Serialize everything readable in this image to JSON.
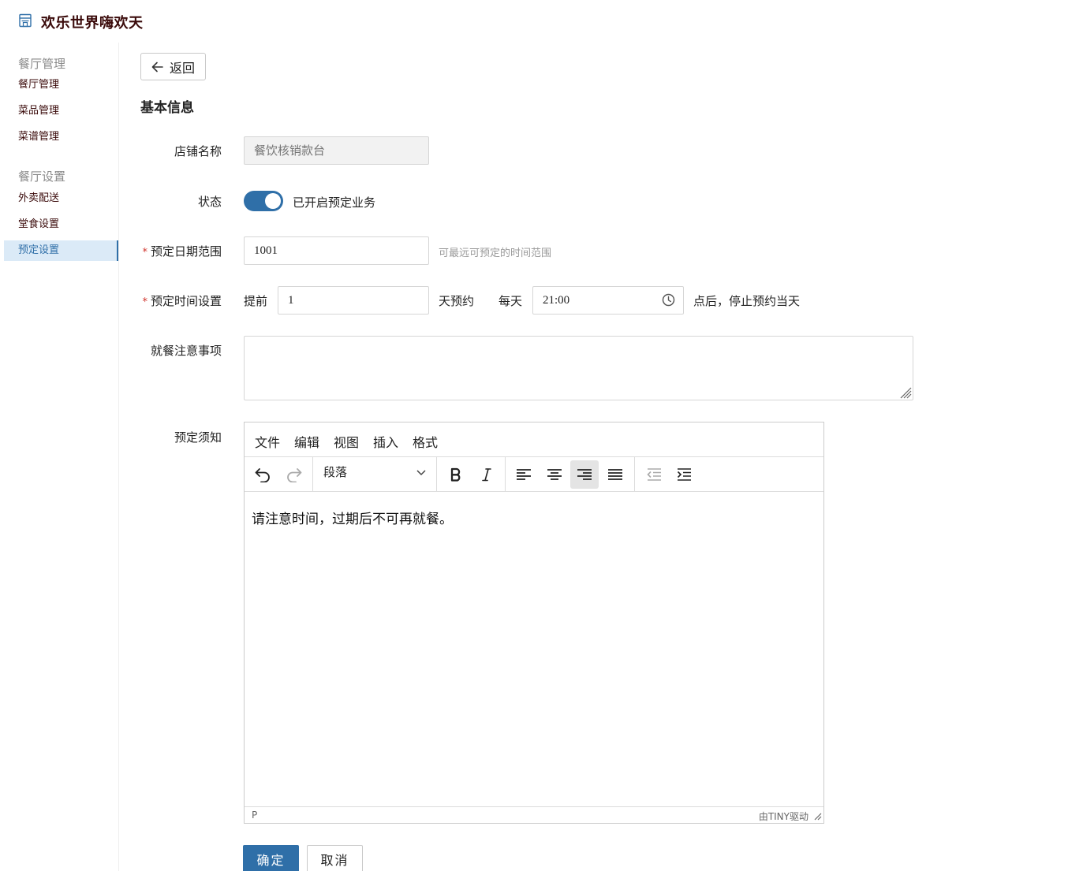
{
  "header": {
    "title": "欢乐世界嗨欢天",
    "logo_icon": "store-icon"
  },
  "sidebar": {
    "groups": [
      {
        "label": "餐厅管理",
        "items": [
          "餐厅管理",
          "菜品管理",
          "菜谱管理"
        ]
      },
      {
        "label": "餐厅设置",
        "items": [
          "外卖配送",
          "堂食设置",
          "预定设置"
        ]
      }
    ],
    "active_item": "预定设置"
  },
  "main": {
    "back_label": "返回",
    "section_title": "基本信息",
    "fields": {
      "store_name": {
        "label": "店铺名称",
        "placeholder": "餐饮核销款台"
      },
      "status": {
        "label": "状态",
        "on": true,
        "text": "已开启预定业务"
      },
      "date_range": {
        "label": "预定日期范围",
        "value": "1001",
        "hint": "可最远可预定的时间范围"
      },
      "time_setting": {
        "label": "预定时间设置",
        "prefix": "提前",
        "days": "1",
        "days_suffix": "天预约",
        "daily": "每天",
        "time": "21:00",
        "suffix": "点后，停止预约当天"
      },
      "dining_notes": {
        "label": "就餐注意事项",
        "value": ""
      },
      "booking_notice": {
        "label": "预定须知"
      }
    },
    "editor": {
      "menus": [
        "文件",
        "编辑",
        "视图",
        "插入",
        "格式"
      ],
      "block_format": "段落",
      "content": "请注意时间，过期后不可再就餐。",
      "status_path": "P",
      "branding": "由TINY驱动",
      "active_align": "align-right"
    },
    "actions": {
      "confirm": "确定",
      "cancel": "取消"
    }
  },
  "colors": {
    "primary": "#2f6fa8",
    "active_bg": "#dbeaf7",
    "title": "#3a0a0a"
  }
}
